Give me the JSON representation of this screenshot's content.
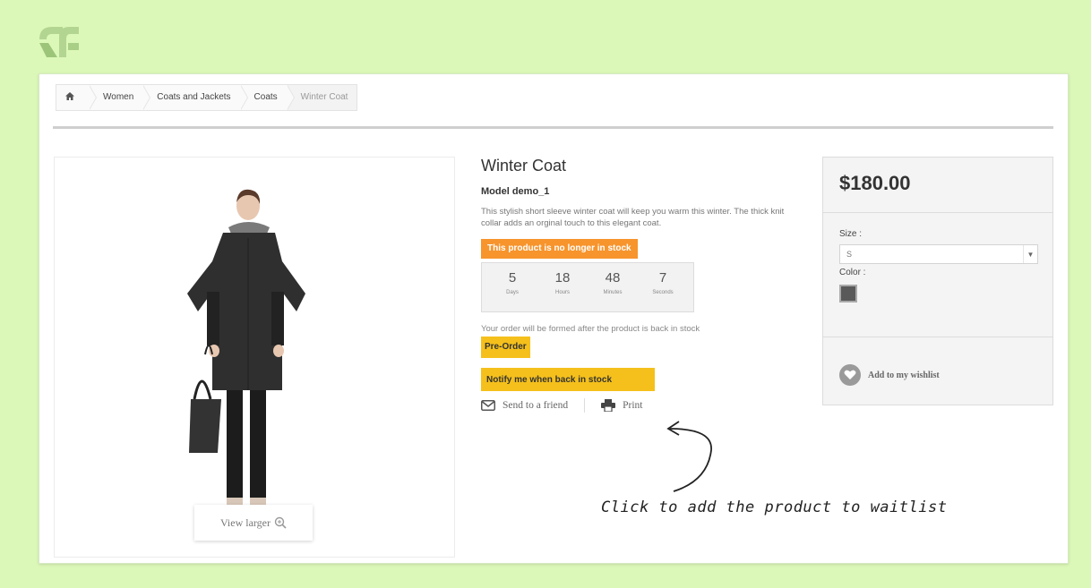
{
  "breadcrumb": {
    "home_icon": "home-icon",
    "items": [
      "Women",
      "Coats and Jackets",
      "Coats"
    ],
    "current": "Winter Coat"
  },
  "image": {
    "view_larger": "View larger"
  },
  "product": {
    "title": "Winter Coat",
    "model": "Model demo_1",
    "description": "This stylish short sleeve winter coat will keep you warm this winter. The thick knit collar adds an orginal touch to this elegant coat.",
    "out_of_stock": "This product is no longer in stock",
    "countdown": [
      {
        "value": "5",
        "label": "Days"
      },
      {
        "value": "18",
        "label": "Hours"
      },
      {
        "value": "48",
        "label": "Minutes"
      },
      {
        "value": "7",
        "label": "Seconds"
      }
    ],
    "back_in_stock_note": "Your order will be formed after the product is back in stock",
    "preorder_label": "Pre-Order",
    "notify_label": "Notify me when back in stock",
    "send_friend": "Send to a friend",
    "print": "Print"
  },
  "annotation": "Click to add the product to waitlist",
  "purchase": {
    "price": "$180.00",
    "size_label": "Size :",
    "size_value": "S",
    "color_label": "Color :",
    "color_value": "#595959",
    "wishlist": "Add to my wishlist"
  },
  "colors": {
    "background": "#dcf8b8",
    "orange": "#f7942c",
    "yellow": "#f5c01b"
  }
}
